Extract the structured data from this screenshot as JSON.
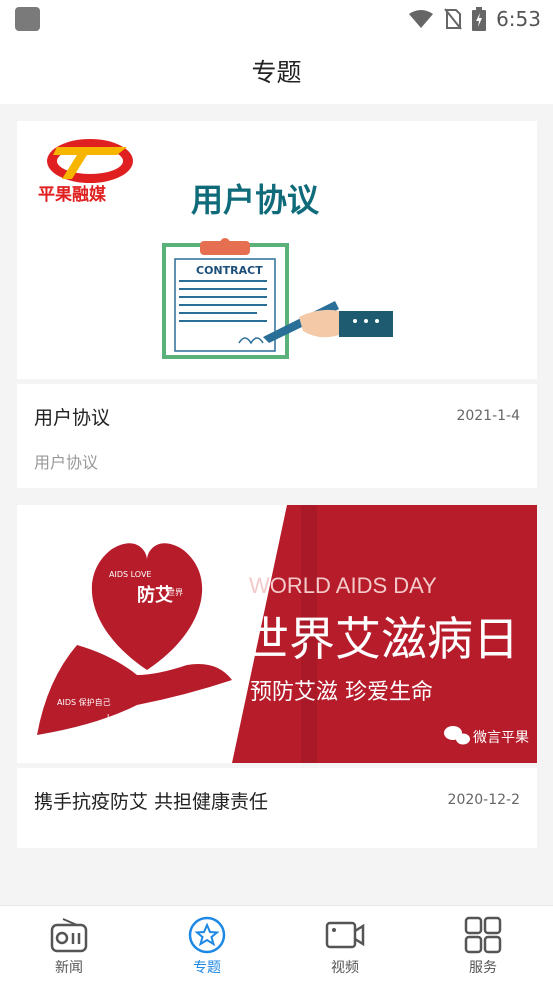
{
  "status_bar": {
    "time": "6:53"
  },
  "header": {
    "title": "专题"
  },
  "cards": [
    {
      "image": {
        "brand": "平果融媒",
        "headline": "用户协议",
        "document_label": "CONTRACT"
      },
      "title": "用户协议",
      "date": "2021-1-4",
      "subtitle": "用户协议"
    },
    {
      "image": {
        "heart_badge": "防艾",
        "line1": "WORLD AIDS DAY",
        "line2": "世界艾滋病日",
        "line3": "预防艾滋 珍爱生命",
        "watermark": "微言平果"
      },
      "title": "携手抗疫防艾 共担健康责任",
      "date": "2020-12-2"
    }
  ],
  "tabs": [
    {
      "label": "新闻",
      "icon": "radio-icon"
    },
    {
      "label": "专题",
      "icon": "star-icon",
      "active": true
    },
    {
      "label": "视频",
      "icon": "video-icon"
    },
    {
      "label": "服务",
      "icon": "grid-icon"
    }
  ],
  "colors": {
    "accent": "#1e88e5",
    "aids_red": "#b71c2b",
    "contract_teal": "#0f6b7a",
    "brand_red": "#e02020"
  }
}
